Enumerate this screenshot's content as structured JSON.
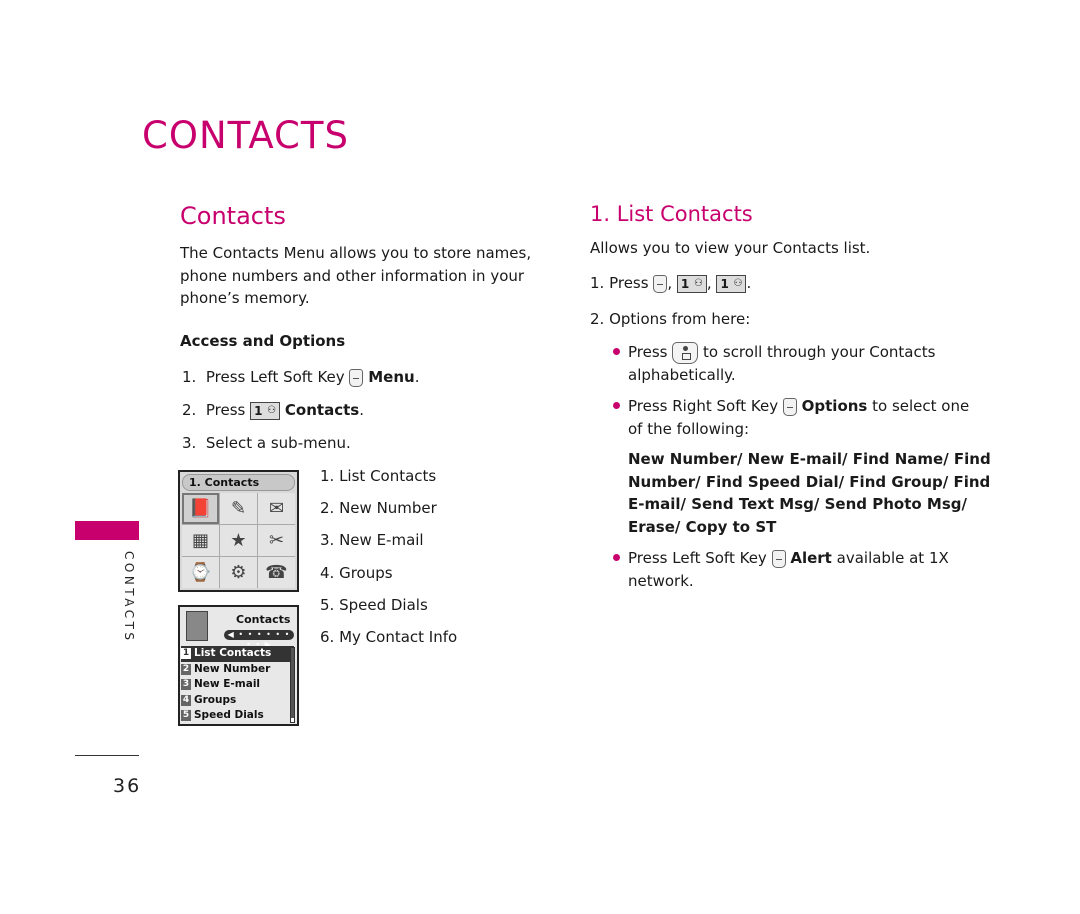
{
  "chapter_title": "CONTACTS",
  "left": {
    "section_title": "Contacts",
    "intro": [
      "The Contacts Menu allows you to store names,",
      "phone numbers and other information in your",
      "phone’s memory."
    ],
    "access_heading": "Access and Options",
    "steps": [
      {
        "num": "1.",
        "text": "Press Left Soft Key",
        "key": "left-soft-key",
        "bold": "Menu",
        "end": "."
      },
      {
        "num": "2.",
        "text": "Press",
        "key": "1-key",
        "bold": "Contacts",
        "end": "."
      },
      {
        "num": "3.",
        "text": "Select a sub-menu.",
        "key": "",
        "bold": "",
        "end": ""
      }
    ],
    "submenu": [
      "1. List Contacts",
      "2. New Number",
      "3. New E-mail",
      "4. Groups",
      "5. Speed Dials",
      "6. My Contact Info"
    ],
    "screen1": {
      "header": "1. Contacts",
      "icons": [
        "contacts-book",
        "notepad",
        "messages",
        "calendar",
        "star",
        "tools",
        "briefcase",
        "settings",
        "phone"
      ]
    },
    "screen2": {
      "title": "Contacts",
      "scroller": "◀ • • • • • • • • ▶",
      "items": [
        {
          "n": "1",
          "label": "List Contacts",
          "selected": true
        },
        {
          "n": "2",
          "label": "New Number",
          "selected": false
        },
        {
          "n": "3",
          "label": "New E-mail",
          "selected": false
        },
        {
          "n": "4",
          "label": "Groups",
          "selected": false
        },
        {
          "n": "5",
          "label": "Speed Dials",
          "selected": false
        }
      ]
    }
  },
  "right": {
    "section_title": "1. List Contacts",
    "intro": "Allows you to view your Contacts list.",
    "step1_prefix": "1. Press",
    "step1_sep1": ",",
    "step1_sep2": ",",
    "step1_end": ".",
    "step2": "2. Options from here:",
    "bullet1_a": "Press",
    "bullet1_b": "to scroll through your Contacts",
    "bullet1_c": "alphabetically.",
    "bullet2_a": "Press Right Soft Key",
    "bullet2_bold": "Options",
    "bullet2_b": "to select one",
    "bullet2_c": "of the following:",
    "options_lines": [
      "New Number/ New E-mail/ Find Name/ Find",
      "Number/ Find Speed Dial/ Find Group/ Find",
      "E-mail/ Send Text Msg/ Send Photo Msg/",
      "Erase/ Copy to ST"
    ],
    "bullet3_a": "Press Left Soft Key",
    "bullet3_bold": "Alert",
    "bullet3_b": "available at 1X",
    "bullet3_c": "network."
  },
  "side_label": "CONTACTS",
  "page_number": "36",
  "colors": {
    "accent": "#c8006e"
  }
}
